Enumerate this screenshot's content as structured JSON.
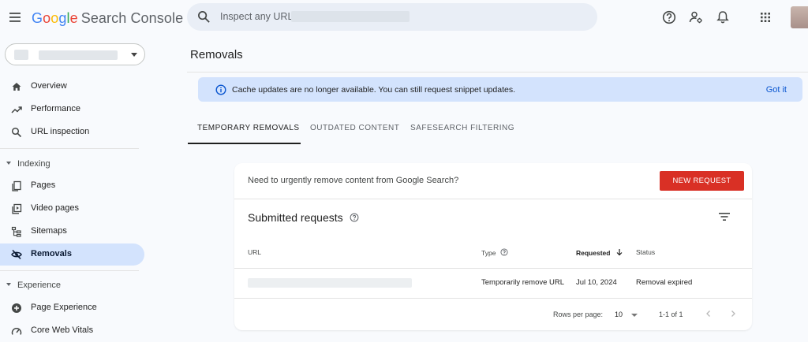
{
  "header": {
    "logo_word": "Google",
    "logo_product": "Search Console",
    "search_placeholder": "Inspect any URL in",
    "icons": [
      "menu-icon",
      "search-icon",
      "help-icon",
      "manage-users-icon",
      "notifications-icon",
      "apps-grid-icon"
    ]
  },
  "sidebar": {
    "nav": [
      {
        "label": "Overview",
        "icon": "home-icon"
      },
      {
        "label": "Performance",
        "icon": "trending-icon"
      },
      {
        "label": "URL inspection",
        "icon": "search-icon"
      }
    ],
    "indexing_label": "Indexing",
    "indexing": [
      {
        "label": "Pages",
        "icon": "pages-icon"
      },
      {
        "label": "Video pages",
        "icon": "video-icon"
      },
      {
        "label": "Sitemaps",
        "icon": "sitemap-icon"
      },
      {
        "label": "Removals",
        "icon": "visibility-off-icon",
        "active": true
      }
    ],
    "experience_label": "Experience",
    "experience": [
      {
        "label": "Page Experience",
        "icon": "plus-circle-icon"
      },
      {
        "label": "Core Web Vitals",
        "icon": "speed-icon"
      }
    ]
  },
  "main": {
    "title": "Removals",
    "banner": {
      "text": "Cache updates are no longer available. You can still request snippet updates.",
      "action": "Got it"
    },
    "tabs": [
      {
        "label": "TEMPORARY REMOVALS",
        "active": true
      },
      {
        "label": "OUTDATED CONTENT"
      },
      {
        "label": "SAFESEARCH FILTERING"
      }
    ],
    "card": {
      "urgent_text": "Need to urgently remove content from Google Search?",
      "new_request": "NEW REQUEST",
      "subtitle": "Submitted requests",
      "columns": {
        "url": "URL",
        "type": "Type",
        "requested": "Requested",
        "status": "Status"
      },
      "rows": [
        {
          "type": "Temporarily remove URL",
          "requested": "Jul 10, 2024",
          "status": "Removal expired"
        }
      ],
      "footer": {
        "rows_per_page_label": "Rows per page:",
        "rows_per_page": "10",
        "range": "1-1 of 1"
      }
    }
  },
  "colors": {
    "accent": "#0b57d0",
    "active_nav": "#d3e3fd",
    "banner": "#d3e3fd",
    "new_request": "#d93025"
  }
}
